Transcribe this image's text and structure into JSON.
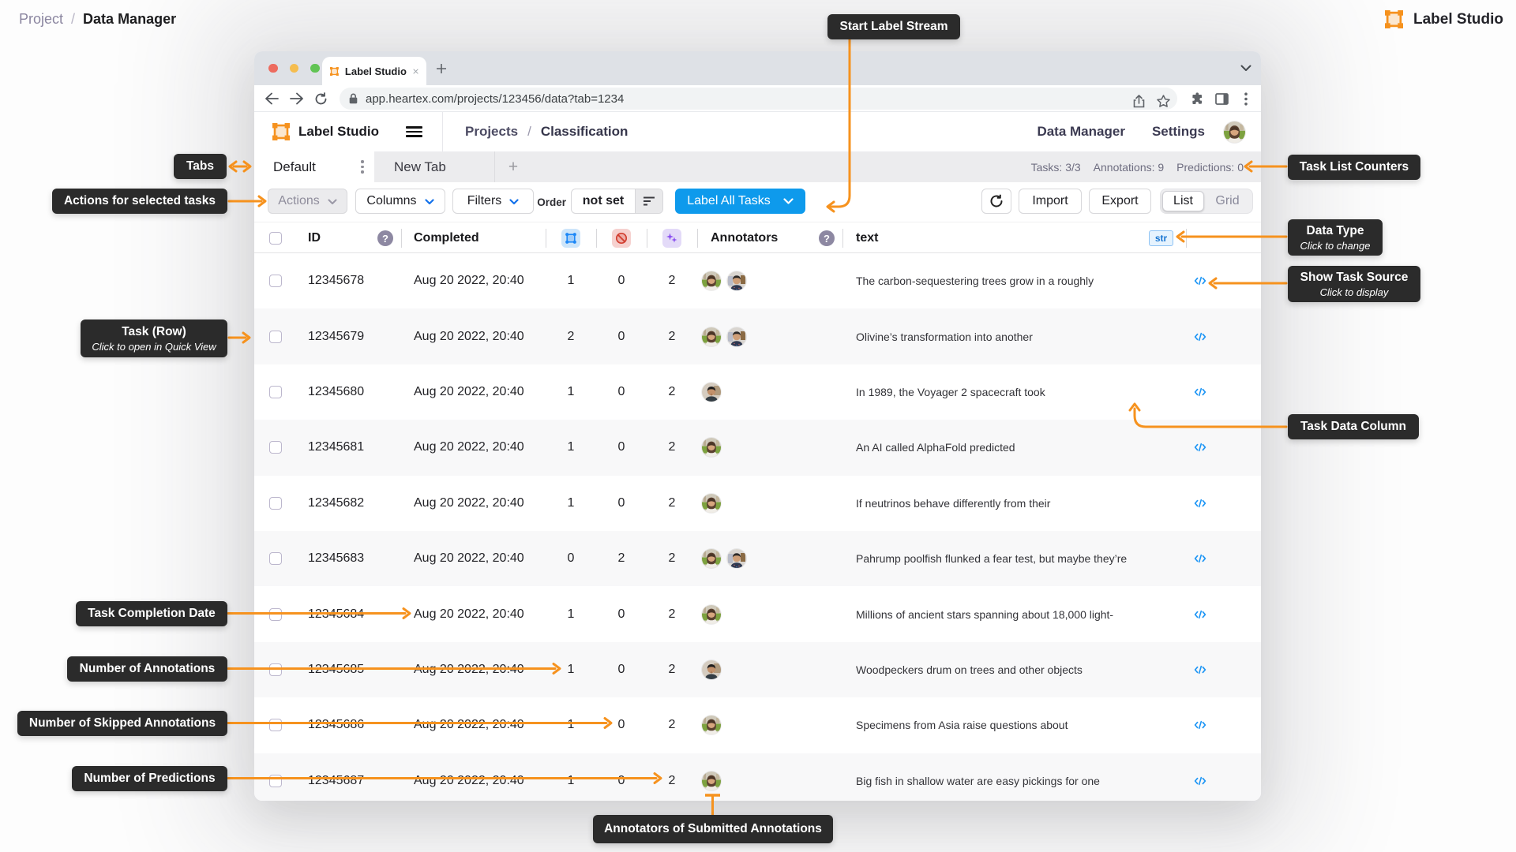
{
  "page": {
    "breadcrumb": {
      "parent": "Project",
      "separator": "/",
      "current": "Data Manager"
    },
    "brand": "Label Studio"
  },
  "browser": {
    "tab_title": "Label Studio",
    "url": "app.heartex.com/projects/123456/data?tab=1234"
  },
  "app_header": {
    "logo_text": "Label Studio",
    "breadcrumb": {
      "parent": "Projects",
      "separator": "/",
      "current": "Classification"
    },
    "nav": {
      "data_manager": "Data Manager",
      "settings": "Settings"
    }
  },
  "tabs": {
    "default_tab": "Default",
    "new_tab": "New Tab",
    "add_tab": "+",
    "counters": {
      "tasks": "Tasks: 3/3",
      "annotations": "Annotations: 9",
      "predictions": "Predictions: 0"
    }
  },
  "toolbar": {
    "actions": "Actions",
    "columns": "Columns",
    "filters": "Filters",
    "order_label": "Order",
    "order_value": "not set",
    "label_all_tasks": "Label All Tasks",
    "import": "Import",
    "export": "Export",
    "view_list": "List",
    "view_grid": "Grid"
  },
  "table": {
    "columns": {
      "id": "ID",
      "completed": "Completed",
      "annotators": "Annotators",
      "text": "text",
      "data_type_badge": "str"
    },
    "rows": [
      {
        "id": "12345678",
        "completed": "Aug 20 2022, 20:40",
        "annotations": "1",
        "skipped": "0",
        "predictions": "2",
        "annotators": [
          "woman",
          "man1"
        ],
        "text": "The carbon-sequestering trees grow in a roughly"
      },
      {
        "id": "12345679",
        "completed": "Aug 20 2022, 20:40",
        "annotations": "2",
        "skipped": "0",
        "predictions": "2",
        "annotators": [
          "woman",
          "man1"
        ],
        "text": "Olivine’s transformation into another"
      },
      {
        "id": "12345680",
        "completed": "Aug 20 2022, 20:40",
        "annotations": "1",
        "skipped": "0",
        "predictions": "2",
        "annotators": [
          "man2"
        ],
        "text": "In 1989, the Voyager 2 spacecraft took"
      },
      {
        "id": "12345681",
        "completed": "Aug 20 2022, 20:40",
        "annotations": "1",
        "skipped": "0",
        "predictions": "2",
        "annotators": [
          "woman"
        ],
        "text": "An AI called AlphaFold predicted"
      },
      {
        "id": "12345682",
        "completed": "Aug 20 2022, 20:40",
        "annotations": "1",
        "skipped": "0",
        "predictions": "2",
        "annotators": [
          "woman"
        ],
        "text": "If neutrinos behave differently from their"
      },
      {
        "id": "12345683",
        "completed": "Aug 20 2022, 20:40",
        "annotations": "0",
        "skipped": "2",
        "predictions": "2",
        "annotators": [
          "woman",
          "man1"
        ],
        "text": "Pahrump poolfish flunked a fear test, but maybe they’re"
      },
      {
        "id": "12345684",
        "completed": "Aug 20 2022, 20:40",
        "annotations": "1",
        "skipped": "0",
        "predictions": "2",
        "annotators": [
          "woman"
        ],
        "text": "Millions of ancient stars spanning about 18,000 light-"
      },
      {
        "id": "12345685",
        "completed": "Aug 20 2022, 20:40",
        "annotations": "1",
        "skipped": "0",
        "predictions": "2",
        "annotators": [
          "man2"
        ],
        "text": "Woodpeckers drum on trees and other objects"
      },
      {
        "id": "12345686",
        "completed": "Aug 20 2022, 20:40",
        "annotations": "1",
        "skipped": "0",
        "predictions": "2",
        "annotators": [
          "woman"
        ],
        "text": "Specimens from Asia raise questions about"
      },
      {
        "id": "12345687",
        "completed": "Aug 20 2022, 20:40",
        "annotations": "1",
        "skipped": "0",
        "predictions": "2",
        "annotators": [
          "woman"
        ],
        "text": "Big fish in shallow water are easy pickings for one"
      }
    ]
  },
  "callouts": {
    "start_label_stream": {
      "title": "Start Label Stream"
    },
    "tabs": {
      "title": "Tabs"
    },
    "actions": {
      "title": "Actions for selected tasks"
    },
    "task_row": {
      "title": "Task (Row)",
      "subtitle": "Click to open in Quick View"
    },
    "completion_date": {
      "title": "Task Completion Date"
    },
    "num_annotations": {
      "title": "Number of Annotations"
    },
    "num_skipped": {
      "title": "Number of Skipped Annotations"
    },
    "num_predictions": {
      "title": "Number of Predictions"
    },
    "task_list_counters": {
      "title": "Task List Counters"
    },
    "data_type": {
      "title": "Data Type",
      "subtitle": "Click to change"
    },
    "show_task_source": {
      "title": "Show Task Source",
      "subtitle": "Click to display"
    },
    "task_data_column": {
      "title": "Task Data Column"
    },
    "annotators_submitted": {
      "title": "Annotators of Submitted Annotations"
    }
  },
  "colors": {
    "accent_orange": "#F6921E",
    "primary_blue": "#0e9aec",
    "callout_bg": "#2b2b2b"
  }
}
